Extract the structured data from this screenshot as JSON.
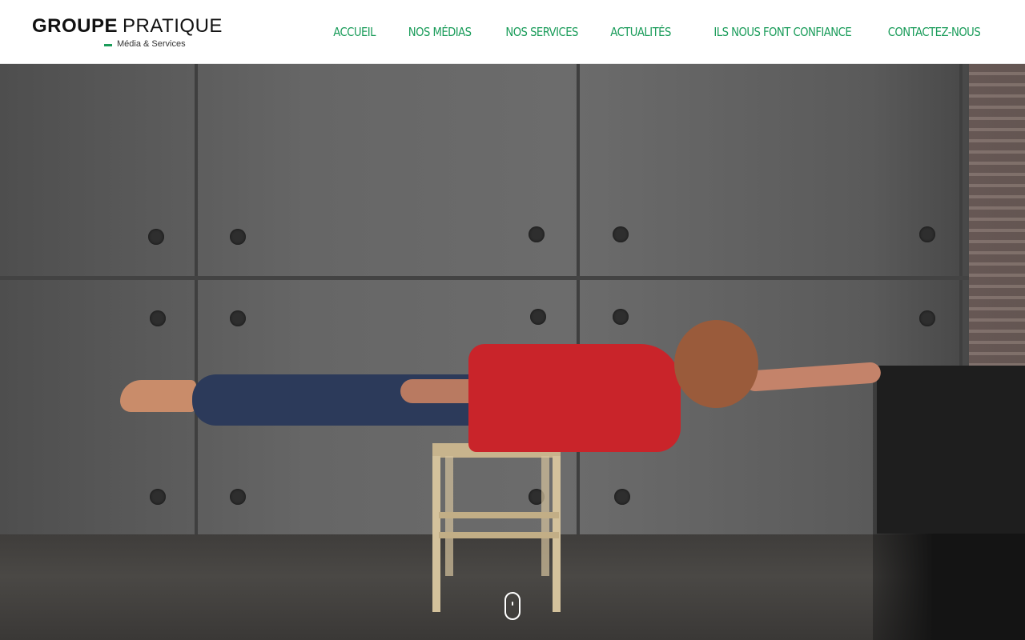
{
  "brand": {
    "name_bold": "GROUPE",
    "name_light": "PRATIQUE",
    "tagline": "Média & Services",
    "accent_color": "#1a9c5a"
  },
  "nav": {
    "items": [
      {
        "label": "ACCUEIL"
      },
      {
        "label": "NOS MÉDIAS"
      },
      {
        "label": "NOS SERVICES"
      },
      {
        "label": "ACTUALITÉS"
      },
      {
        "label": "ILS NOUS FONT CONFIANCE"
      },
      {
        "label": "CONTACTEZ-NOUS"
      }
    ]
  },
  "hero": {
    "image_subject": "man-balancing-on-stool",
    "scroll_icon": "mouse-scroll-icon"
  }
}
